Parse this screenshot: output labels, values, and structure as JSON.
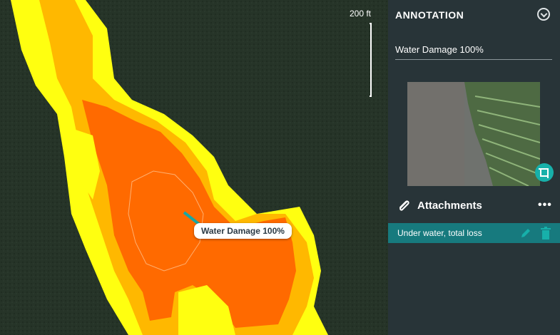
{
  "map": {
    "scale_label": "200 ft",
    "callout_label": "Water Damage 100%",
    "zone_colors": {
      "outer": "#ffff10",
      "mid": "#ffb800",
      "inner": "#ff6a00",
      "background": "#24332a"
    }
  },
  "panel": {
    "header": "ANNOTATION",
    "annotation_text": "Water Damage 100%",
    "attachments_title": "Attachments",
    "attachments": [
      {
        "name": "Under water, total loss"
      }
    ],
    "accent_color": "#177a7e"
  },
  "icons": {
    "collapse": "chevron-down-circle-icon",
    "photo_tool": "crop-icon",
    "attachments": "paperclip-icon",
    "more": "more-horizontal-icon",
    "edit": "pencil-icon",
    "delete": "trash-icon"
  }
}
